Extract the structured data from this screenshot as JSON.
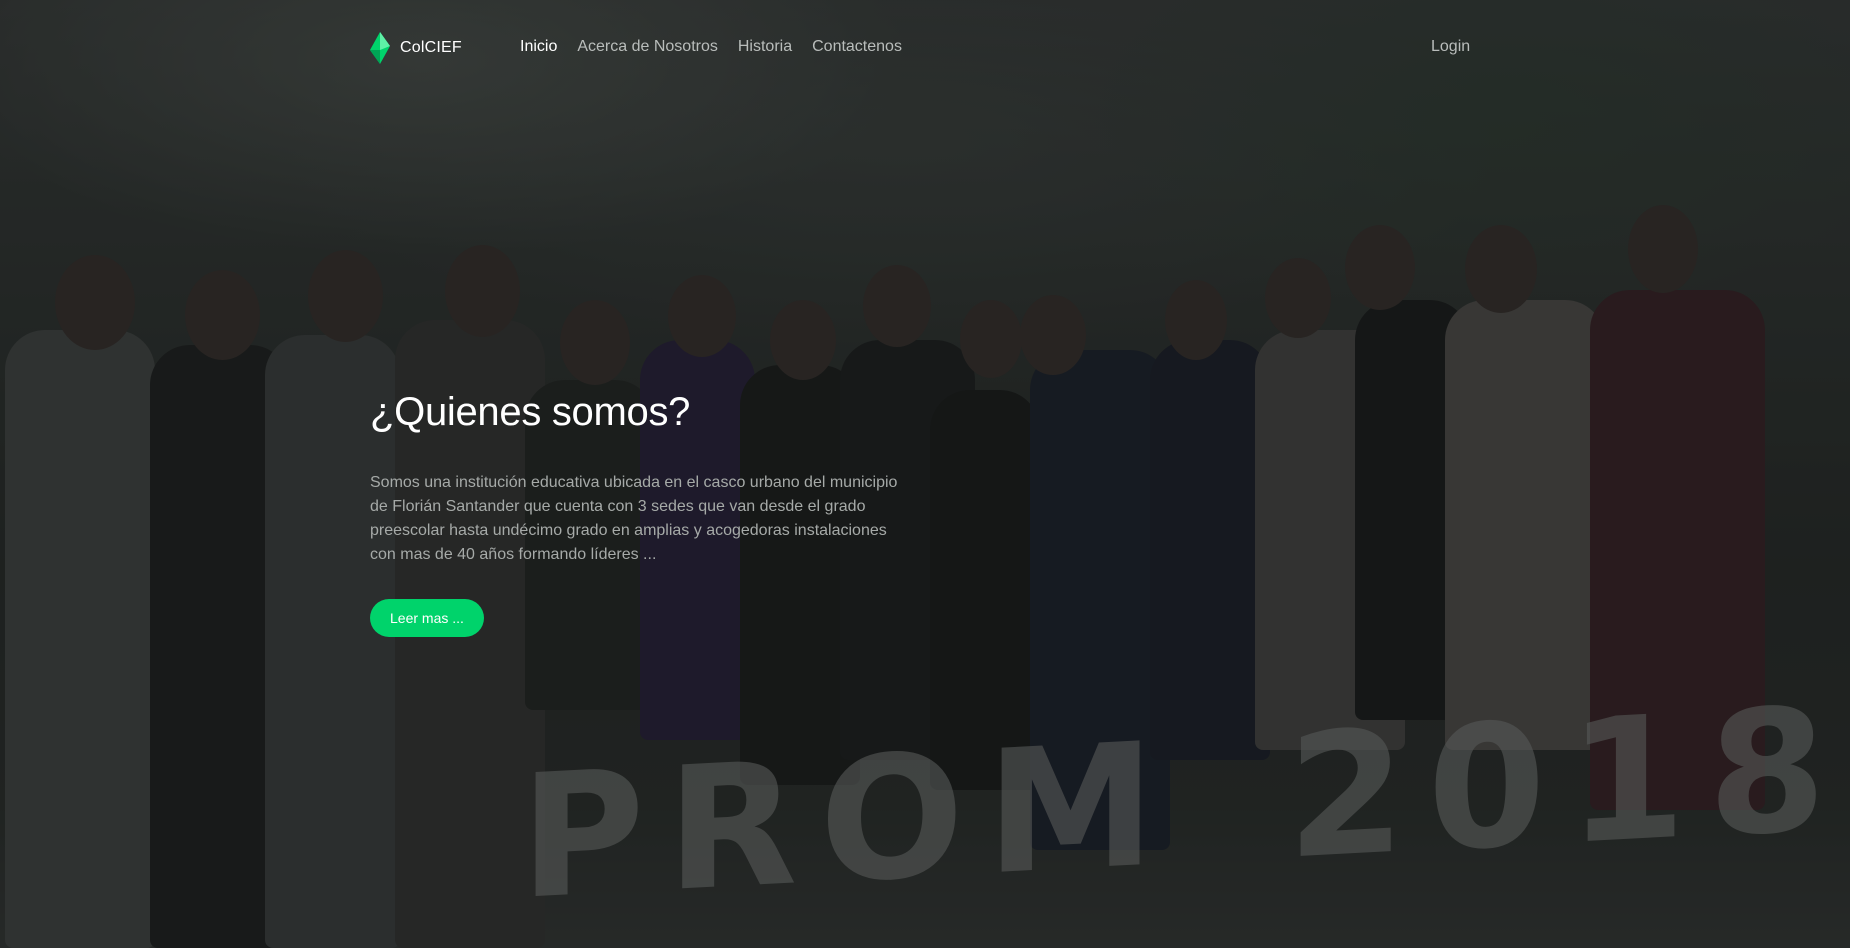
{
  "brand": {
    "name": "ColCIEF",
    "icon": "diamond-leaf-icon",
    "accent": "#00d36b"
  },
  "nav": {
    "items": [
      {
        "label": "Inicio",
        "active": true
      },
      {
        "label": "Acerca de Nosotros",
        "active": false
      },
      {
        "label": "Historia",
        "active": false
      },
      {
        "label": "Contactenos",
        "active": false
      }
    ],
    "login_label": "Login"
  },
  "hero": {
    "title": "¿Quienes somos?",
    "text": "Somos una institución educativa ubicada en el casco urbano del municipio de Florián Santander que cuenta con 3 sedes que van desde el grado preescolar hasta undécimo grado en amplias y acogedoras instalaciones con mas de 40 años formando líderes ...",
    "button_label": "Leer mas ...",
    "background_text": "PROM 2018"
  }
}
